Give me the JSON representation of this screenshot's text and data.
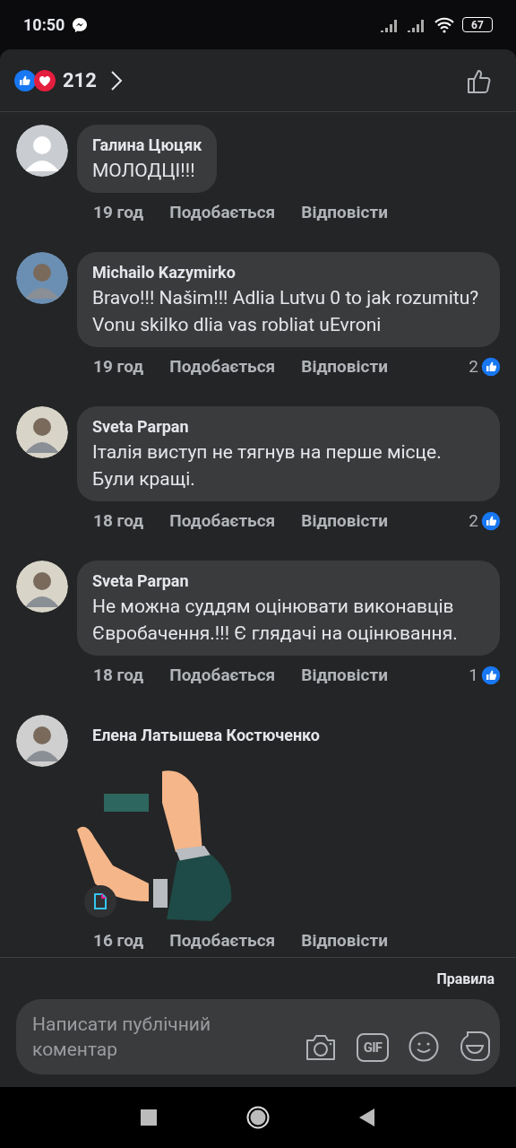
{
  "status_bar": {
    "time": "10:50",
    "battery": "67"
  },
  "header": {
    "reaction_count": "212"
  },
  "comments": [
    {
      "kind": "text",
      "author": "Галина Цюцяк",
      "text": "МОЛОДЦІ!!!",
      "time": "19 год",
      "like": "Подобається",
      "reply": "Відповісти"
    },
    {
      "kind": "text",
      "author": "Michailo Kazymirko",
      "text": "Bravo!!! Našim!!! Adlia Lutvu 0  to jak rozumitu? Vonu skilko  dlia vas robliat uEvroni",
      "time": "19 год",
      "like": "Подобається",
      "reply": "Відповісти",
      "likes": "2"
    },
    {
      "kind": "text",
      "author": "Sveta Parpan",
      "text": "Італія виступ не тягнув на перше місце. Були кращі.",
      "time": "18 год",
      "like": "Подобається",
      "reply": "Відповісти",
      "likes": "2"
    },
    {
      "kind": "text",
      "author": "Sveta Parpan",
      "text": "Не можна суддям оцінювати виконавців Євробачення.!!! Є глядачі на оцінювання.",
      "time": "18 год",
      "like": "Подобається",
      "reply": "Відповісти",
      "likes": "1"
    },
    {
      "kind": "sticker",
      "author": "Елена Латышева Костюченко",
      "time": "16 год",
      "like": "Подобається",
      "reply": "Відповісти"
    }
  ],
  "rules_link": "Правила",
  "composer": {
    "placeholder": "Написати публічний коментар",
    "gif_label": "GIF"
  }
}
